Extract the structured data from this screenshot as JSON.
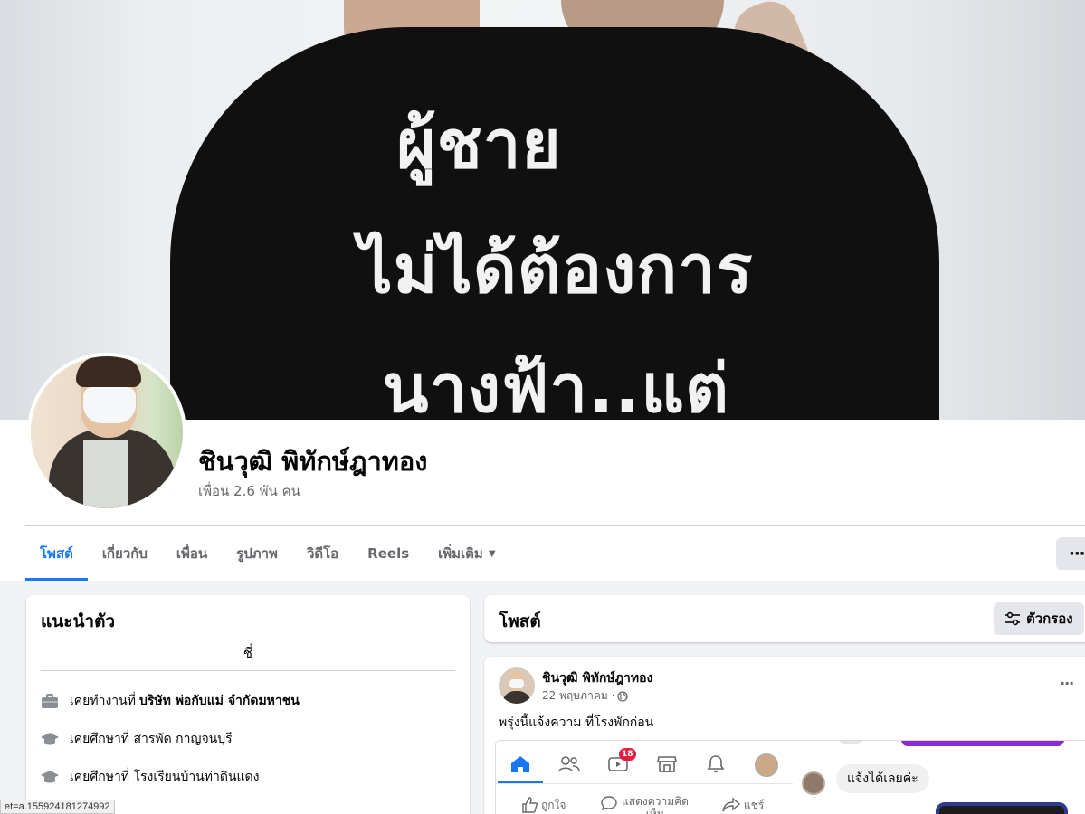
{
  "cover": {
    "line1": "ผู้ชาย",
    "line2": "ไม่ได้ต้องการ",
    "line3": "นางฟ้า..แต่"
  },
  "profile": {
    "name": "ชินวุฒิ พิทักษ์ฎาทอง",
    "friends": "เพื่อน 2.6 พัน คน"
  },
  "tabs": [
    {
      "label": "โพสต์",
      "active": true
    },
    {
      "label": "เกี่ยวกับ"
    },
    {
      "label": "เพื่อน"
    },
    {
      "label": "รูปภาพ"
    },
    {
      "label": "วิดีโอ"
    },
    {
      "label": "Reels"
    },
    {
      "label": "เพิ่มเติม"
    }
  ],
  "more_button": "···",
  "intro": {
    "title": "แนะนำตัว",
    "bio": "ชี่",
    "items": [
      {
        "icon": "briefcase-icon",
        "prefix": "เคยทำงานที่",
        "bold": "บริษัท พ่อกับแม่ จำกัดมหาชน"
      },
      {
        "icon": "graduation-cap-icon",
        "prefix": "เคยศึกษาที่ สารพัด กาญจนบุรี",
        "bold": ""
      },
      {
        "icon": "graduation-cap-icon",
        "prefix": "เคยศึกษาที่ โรงเรียนบ้านท่าดินแดง",
        "bold": ""
      }
    ]
  },
  "status_bar": "et=a.155924181274992",
  "posts": {
    "title": "โพสต์",
    "filter_label": "ตัวกรอง"
  },
  "post": {
    "author": "ชินวุฒิ พิทักษ์ฎาทอง",
    "date": "22 พฤษภาคม ·",
    "privacy_icon": "globe-icon",
    "text": "พรุ่งนี้แจ้งความ ที่โรงพักก่อน",
    "screenshot": {
      "badge_count": "18",
      "like_label": "ถูกใจ",
      "comment_label": "แสดงความคิดเห็น",
      "share_label": "แชร์",
      "message": "แจ้งได้เลยค่ะ"
    }
  },
  "colors": {
    "accent": "#1877f2",
    "background": "#f0f2f5",
    "secondary_text": "#65676b",
    "badge": "#e41e3f"
  }
}
